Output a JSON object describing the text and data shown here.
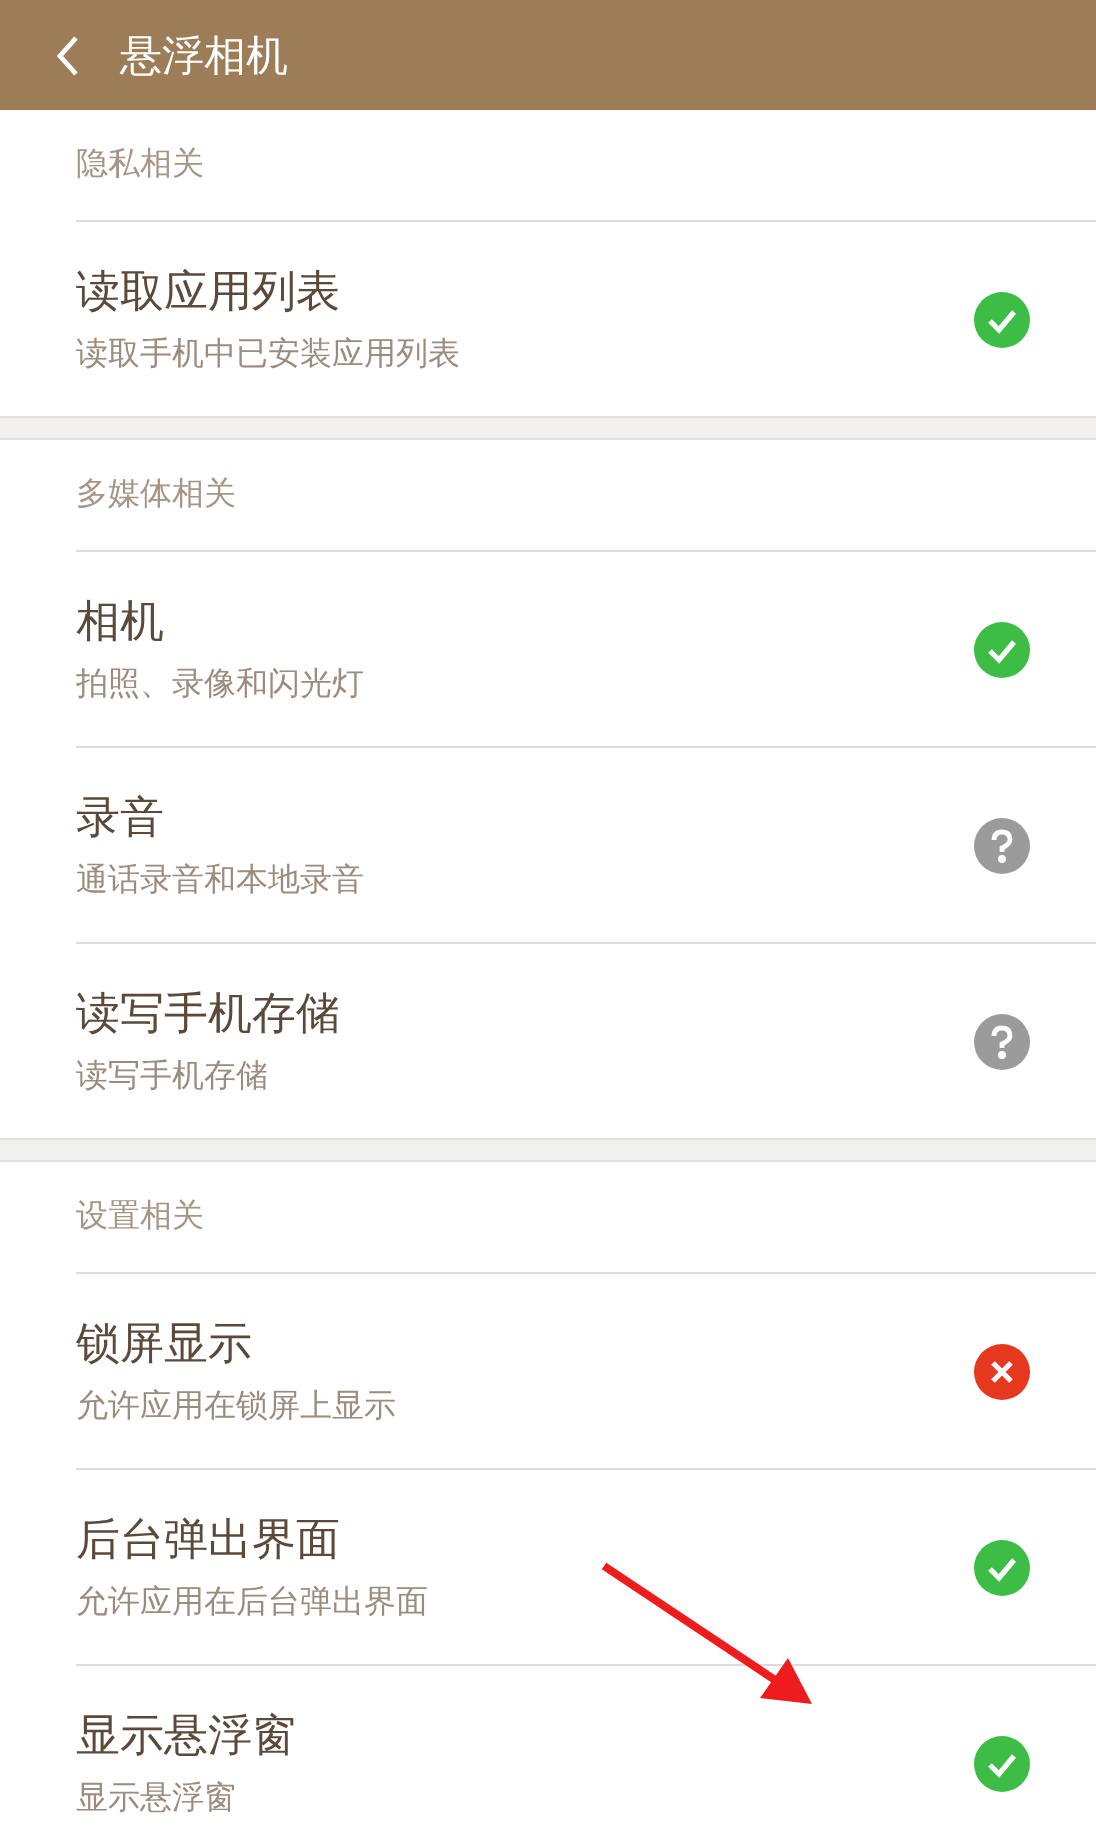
{
  "header": {
    "title": "悬浮相机"
  },
  "sections": [
    {
      "title": "隐私相关",
      "items": [
        {
          "title": "读取应用列表",
          "subtitle": "读取手机中已安装应用列表",
          "kind": "allowed"
        }
      ]
    },
    {
      "title": "多媒体相关",
      "items": [
        {
          "title": "相机",
          "subtitle": "拍照、录像和闪光灯",
          "kind": "allowed"
        },
        {
          "title": "录音",
          "subtitle": "通话录音和本地录音",
          "kind": "ask"
        },
        {
          "title": "读写手机存储",
          "subtitle": "读写手机存储",
          "kind": "ask"
        }
      ]
    },
    {
      "title": "设置相关",
      "items": [
        {
          "title": "锁屏显示",
          "subtitle": "允许应用在锁屏上显示",
          "kind": "denied"
        },
        {
          "title": "后台弹出界面",
          "subtitle": "允许应用在后台弹出界面",
          "kind": "allowed"
        },
        {
          "title": "显示悬浮窗",
          "subtitle": "显示悬浮窗",
          "kind": "allowed"
        }
      ]
    }
  ]
}
